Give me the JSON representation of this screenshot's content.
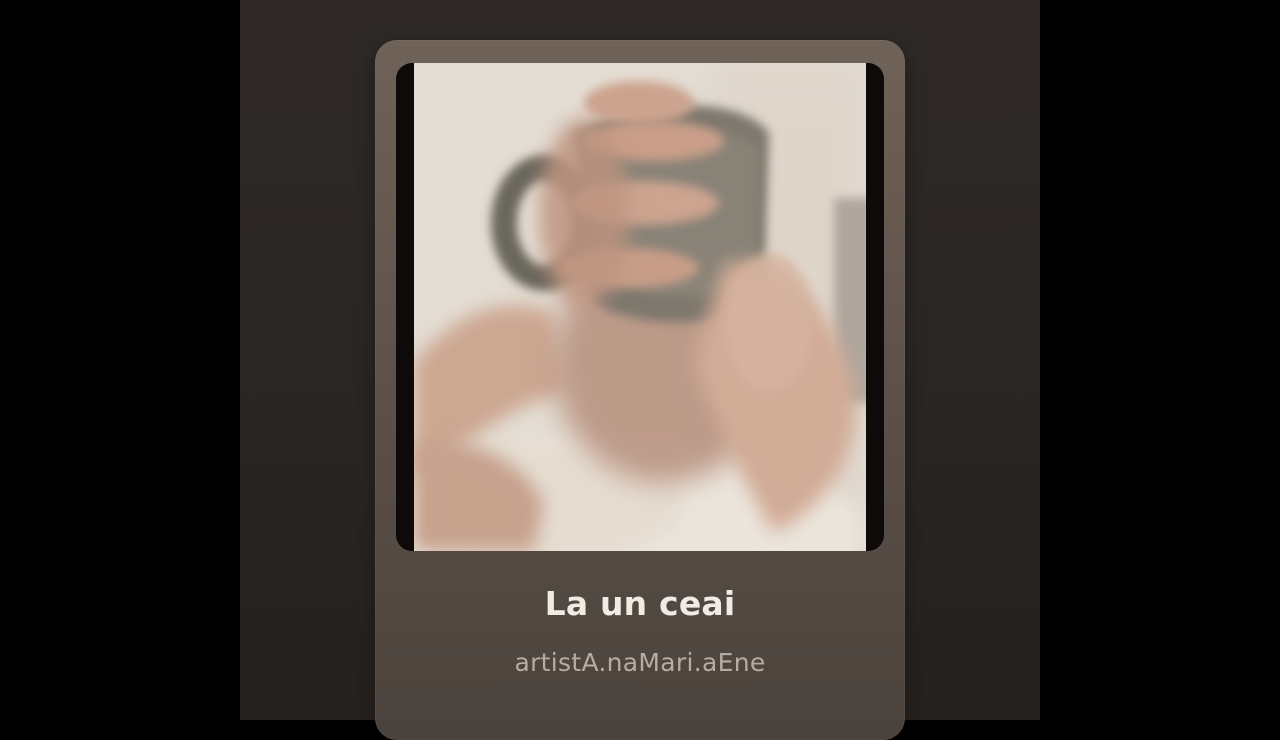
{
  "track": {
    "title": "La un ceai",
    "artist": "artistA.naMari.aEne"
  },
  "cover_art": {
    "subject": "blurred-person-drinking-from-mug"
  },
  "colors": {
    "background": "#000000",
    "panel": "#2b2725",
    "card": "#5e534b",
    "title_text": "#f1ebe4",
    "artist_text": "#b7aca3"
  }
}
